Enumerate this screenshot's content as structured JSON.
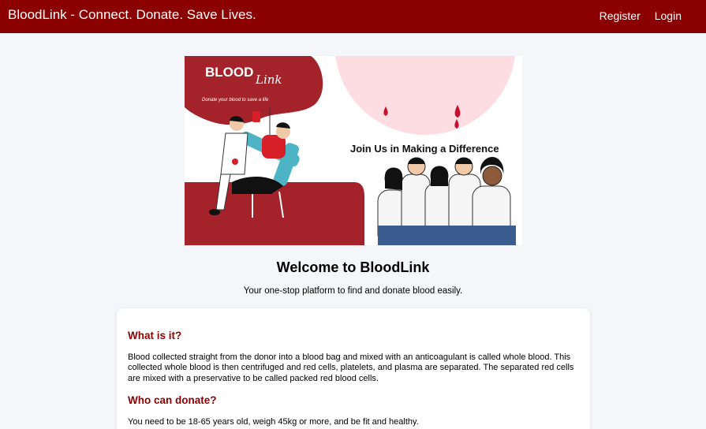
{
  "navbar": {
    "brand": "BloodLink - Connect. Donate. Save Lives.",
    "links": [
      "Register",
      "Login"
    ],
    "color": "#8b0000"
  },
  "hero": {
    "logo_word": "BLOOD",
    "logo_script": "Link",
    "logo_tagline": "Donate your blood to save a life",
    "headline": "Join Us in Making a Difference"
  },
  "welcome": {
    "title": "Welcome to BloodLink",
    "subtitle": "Your one-stop platform to find and donate blood easily."
  },
  "info": {
    "what_heading": "What is it?",
    "what_text": "Blood collected straight from the donor into a blood bag and mixed with an anticoagulant is called whole blood. This collected whole blood is then centrifuged and red cells, platelets, and plasma are separated. The separated red cells are mixed with a preservative to be called packed red blood cells.",
    "who_heading": "Who can donate?",
    "who_text": "You need to be 18-65 years old, weigh 45kg or more, and be fit and healthy."
  }
}
